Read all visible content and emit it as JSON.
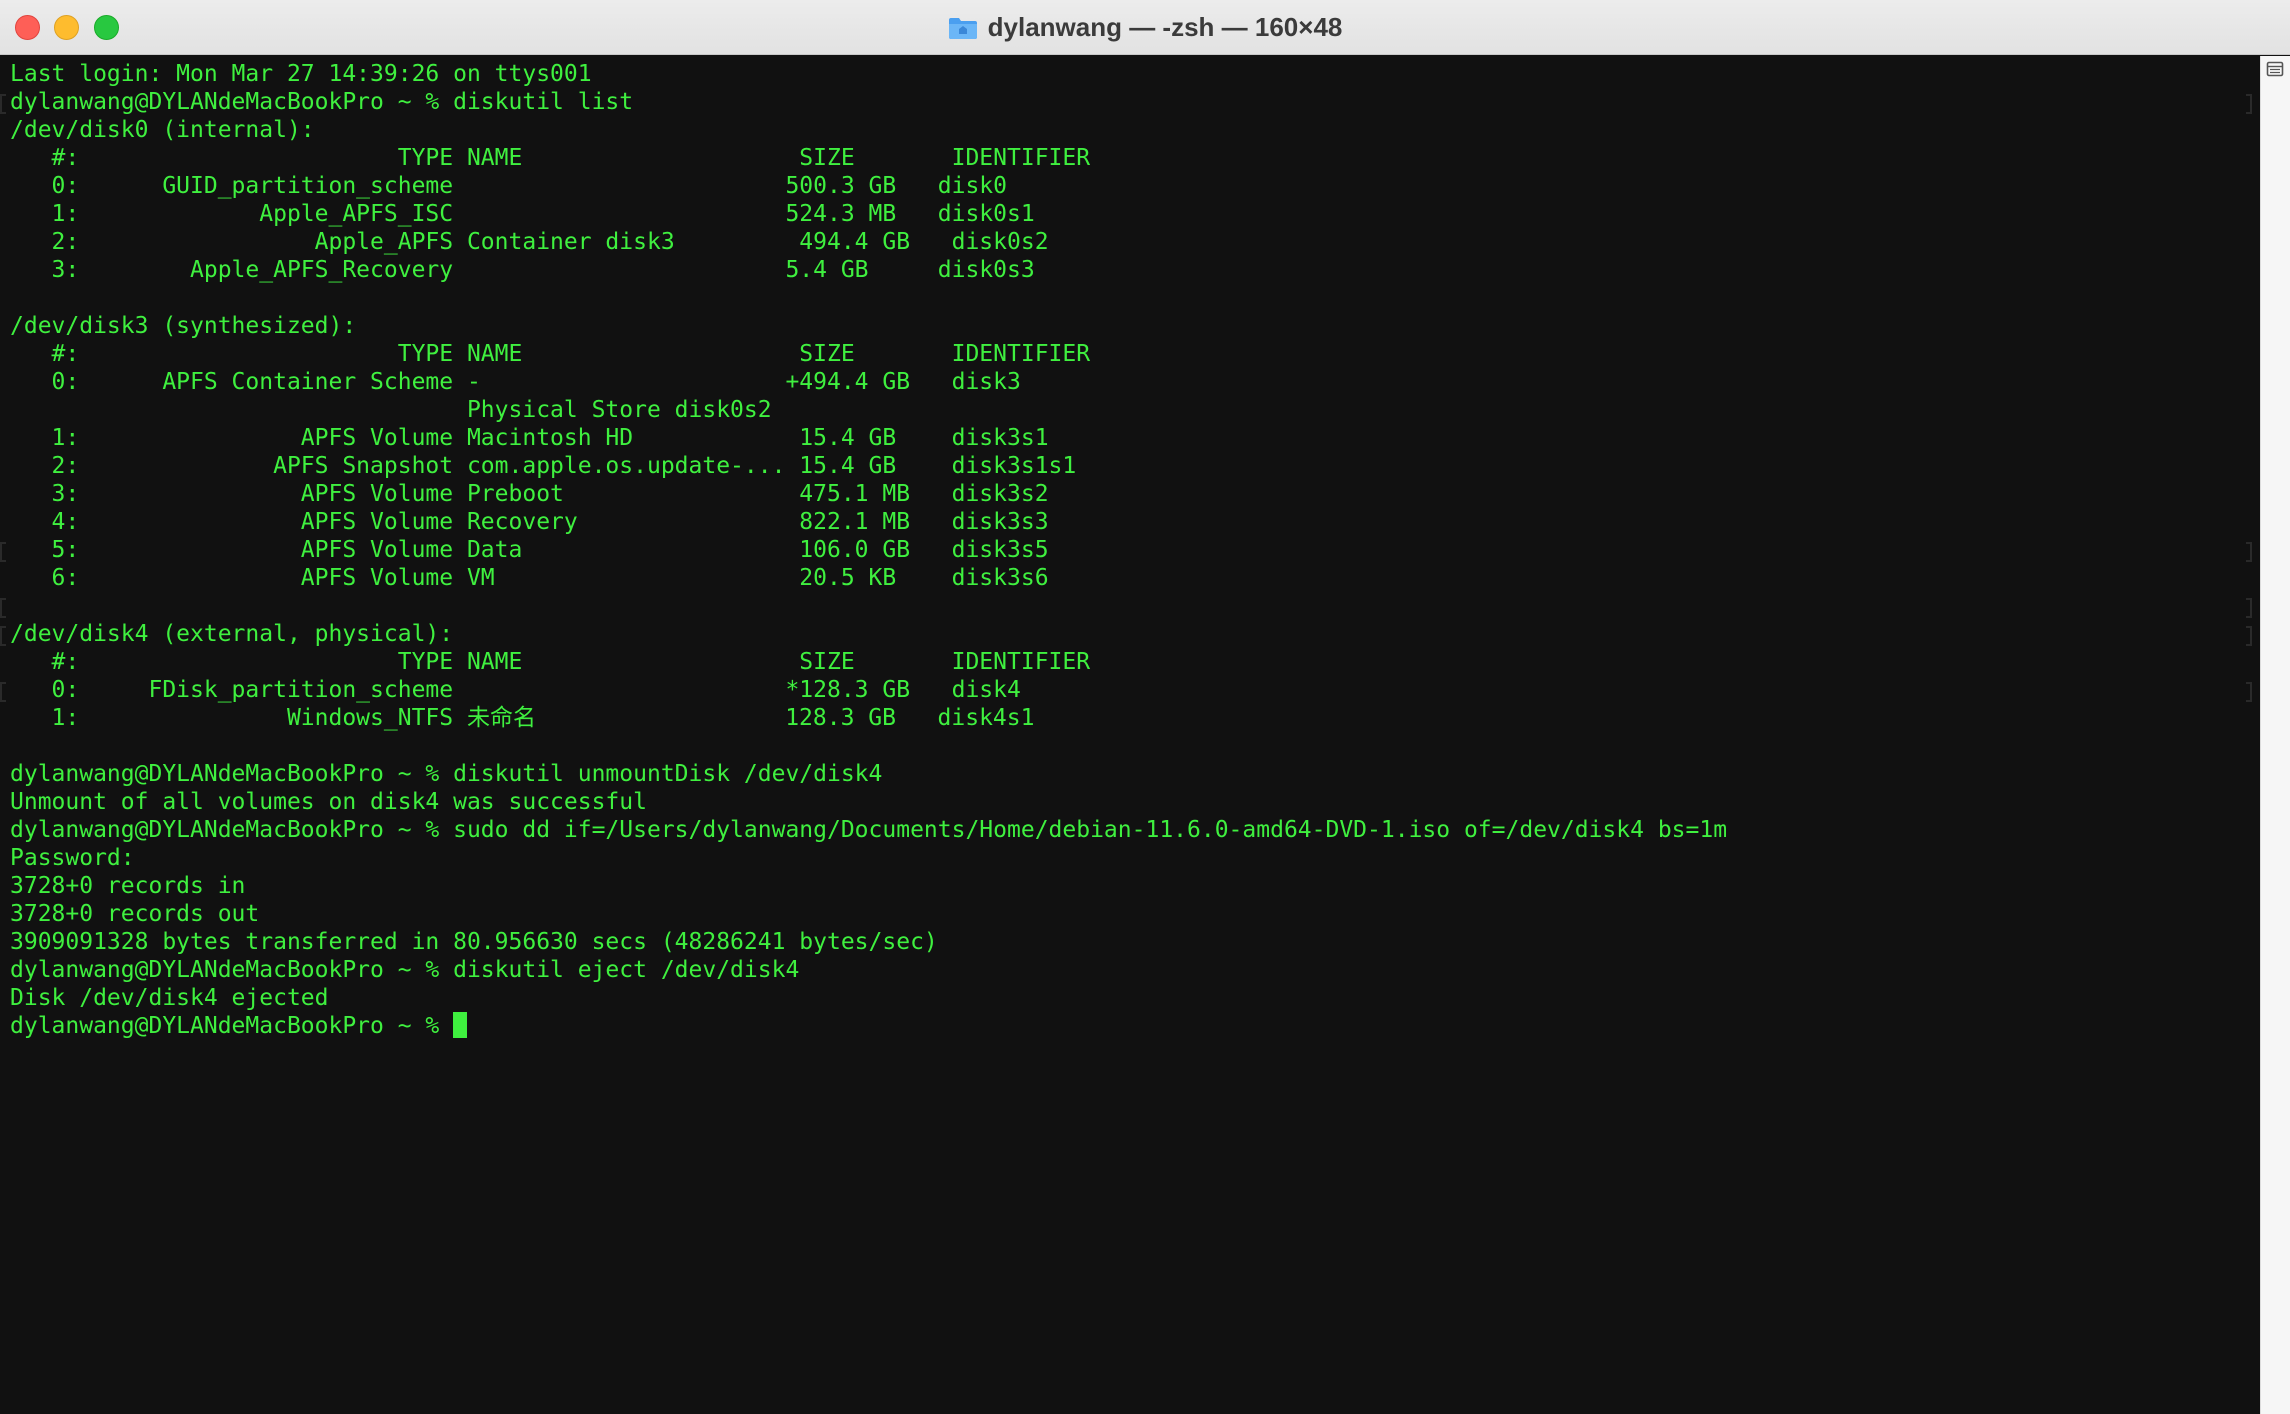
{
  "window": {
    "title": "dylanwang — -zsh — 160×48"
  },
  "terminal": {
    "lines": [
      "Last login: Mon Mar 27 14:39:26 on ttys001",
      "dylanwang@DYLANdeMacBookPro ~ % diskutil list",
      "/dev/disk0 (internal):",
      "   #:                       TYPE NAME                    SIZE       IDENTIFIER",
      "   0:      GUID_partition_scheme                        500.3 GB   disk0",
      "   1:             Apple_APFS_ISC                        524.3 MB   disk0s1",
      "   2:                 Apple_APFS Container disk3         494.4 GB   disk0s2",
      "   3:        Apple_APFS_Recovery                        5.4 GB     disk0s3",
      "",
      "/dev/disk3 (synthesized):",
      "   #:                       TYPE NAME                    SIZE       IDENTIFIER",
      "   0:      APFS Container Scheme -                      +494.4 GB   disk3",
      "                                 Physical Store disk0s2",
      "   1:                APFS Volume Macintosh HD            15.4 GB    disk3s1",
      "   2:              APFS Snapshot com.apple.os.update-... 15.4 GB    disk3s1s1",
      "   3:                APFS Volume Preboot                 475.1 MB   disk3s2",
      "   4:                APFS Volume Recovery                822.1 MB   disk3s3",
      "   5:                APFS Volume Data                    106.0 GB   disk3s5",
      "   6:                APFS Volume VM                      20.5 KB    disk3s6",
      "",
      "/dev/disk4 (external, physical):",
      "   #:                       TYPE NAME                    SIZE       IDENTIFIER",
      "   0:     FDisk_partition_scheme                        *128.3 GB   disk4",
      "   1:               Windows_NTFS 未命名                  128.3 GB   disk4s1",
      "",
      "dylanwang@DYLANdeMacBookPro ~ % diskutil unmountDisk /dev/disk4",
      "Unmount of all volumes on disk4 was successful",
      "dylanwang@DYLANdeMacBookPro ~ % sudo dd if=/Users/dylanwang/Documents/Home/debian-11.6.0-amd64-DVD-1.iso of=/dev/disk4 bs=1m",
      "Password:",
      "3728+0 records in",
      "3728+0 records out",
      "3909091328 bytes transferred in 80.956630 secs (48286241 bytes/sec)",
      "dylanwang@DYLANdeMacBookPro ~ % diskutil eject /dev/disk4",
      "Disk /dev/disk4 ejected",
      "dylanwang@DYLANdeMacBookPro ~ % "
    ]
  },
  "colors": {
    "text": "#3ff03f",
    "background": "#111111"
  },
  "icons": {
    "title": "folder-icon",
    "scrollbar": "sidebar-toggle-icon"
  }
}
